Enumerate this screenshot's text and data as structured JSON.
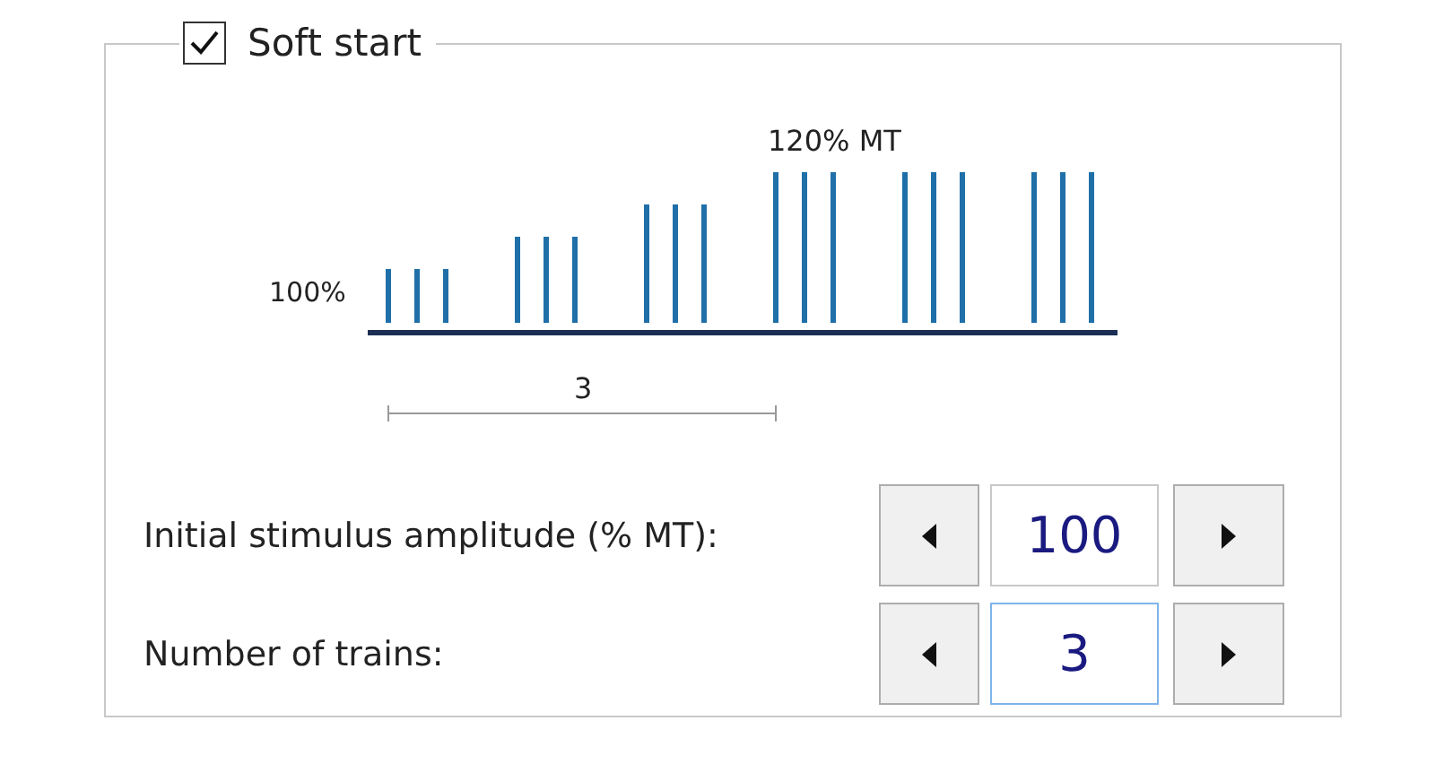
{
  "group": {
    "label": "Soft start",
    "checked": true
  },
  "diagram": {
    "base_label": "100%",
    "peak_label": "120% MT",
    "span_label": "3"
  },
  "rows": [
    {
      "label": "Initial stimulus amplitude (% MT):",
      "value": "100",
      "focused": false
    },
    {
      "label": "Number of trains:",
      "value": "3",
      "focused": true
    }
  ]
}
